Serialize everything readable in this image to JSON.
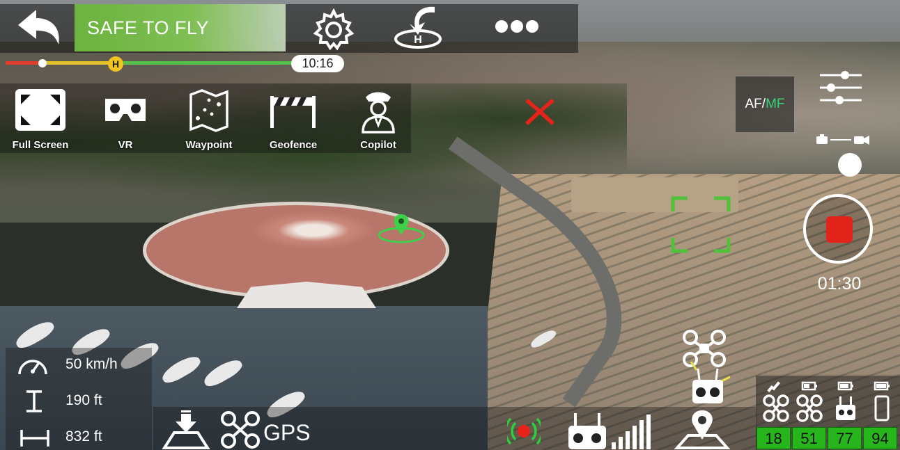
{
  "app": {
    "status_banner": "SAFE TO FLY",
    "flight_time_remaining": "10:16",
    "home_marker_label": "H",
    "colors": {
      "safe_green": "#6cb33f",
      "record_red": "#e2231a",
      "battery_green": "#26b61c",
      "focus_green": "#4fc23a",
      "mf_green": "#37d37a"
    }
  },
  "header": {
    "icons": [
      "back-arrow-icon",
      "gear-icon",
      "return-home-icon",
      "more-dots-icon"
    ]
  },
  "features": [
    {
      "label": "Full Screen",
      "icon": "fullscreen-icon"
    },
    {
      "label": "VR",
      "icon": "vr-goggles-icon"
    },
    {
      "label": "Waypoint",
      "icon": "map-waypoint-icon"
    },
    {
      "label": "Geofence",
      "icon": "geofence-icon"
    },
    {
      "label": "Copilot",
      "icon": "pilot-icon"
    }
  ],
  "focus_mode": {
    "af": "AF",
    "separator": "/",
    "mf": "MF"
  },
  "recording": {
    "time": "01:30"
  },
  "stats": {
    "speed": "50 km/h",
    "altitude": "190 ft",
    "distance": "832 ft"
  },
  "bottom": {
    "gps_label": "GPS"
  },
  "batteries": [
    {
      "value": "18",
      "icon": "drone-signal-icon"
    },
    {
      "value": "51",
      "icon": "drone-battery-icon"
    },
    {
      "value": "77",
      "icon": "controller-battery-icon"
    },
    {
      "value": "94",
      "icon": "phone-battery-icon"
    }
  ]
}
